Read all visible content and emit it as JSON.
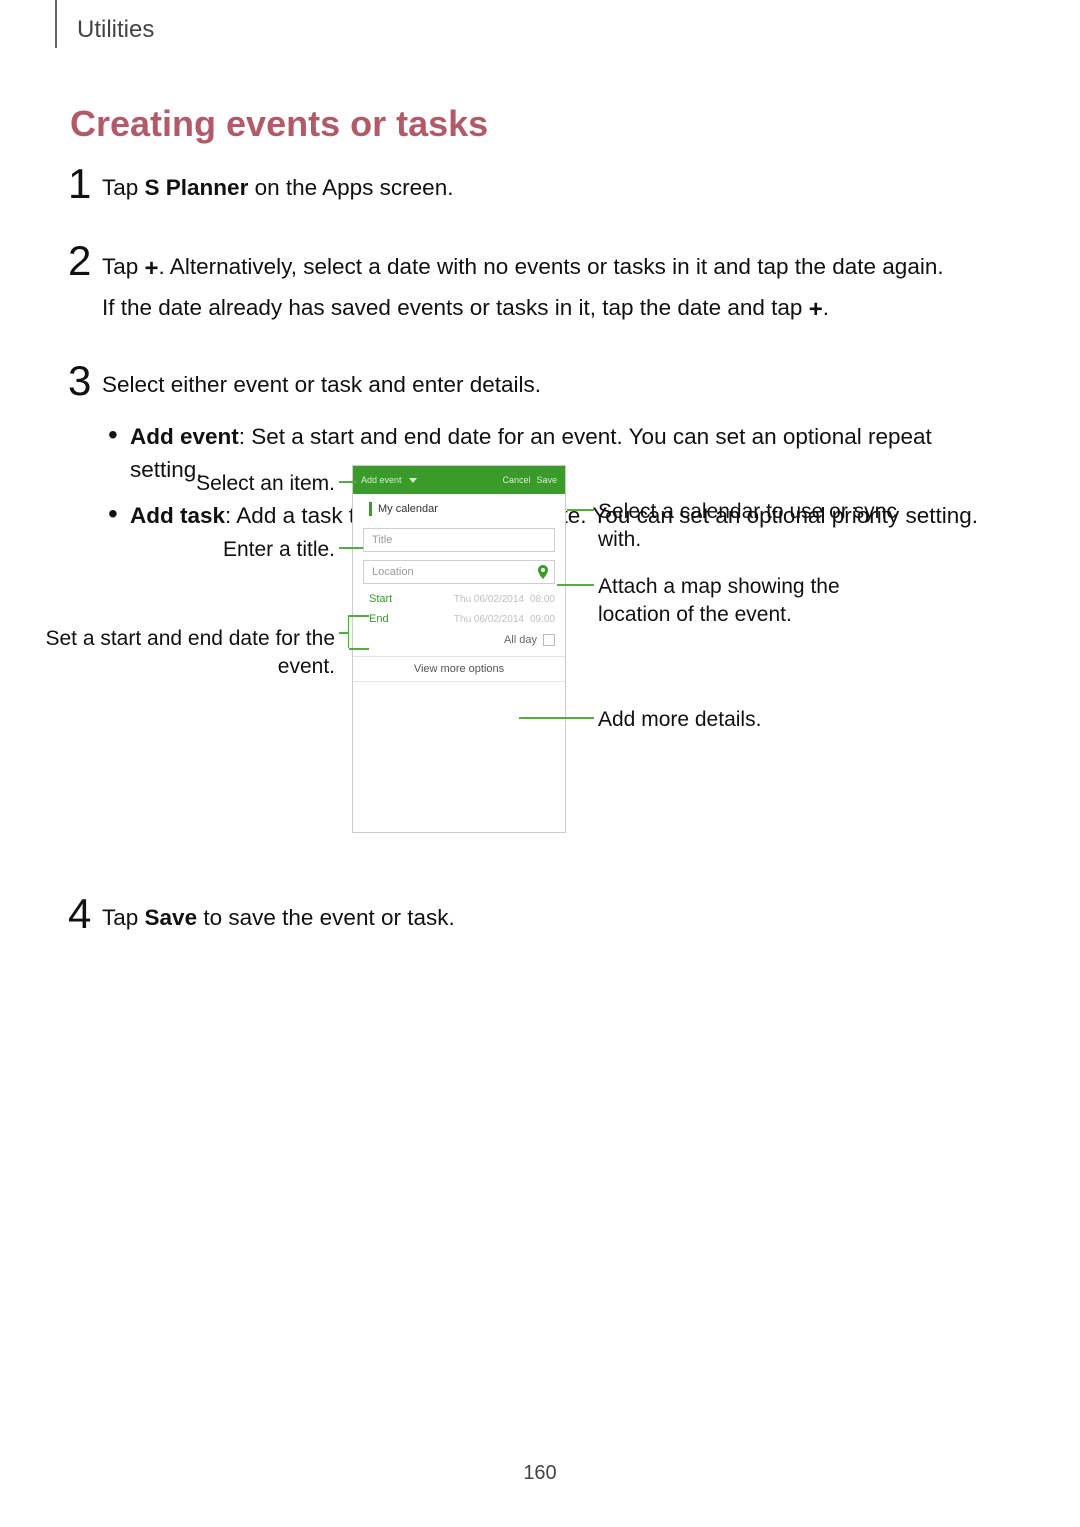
{
  "header": {
    "section": "Utilities"
  },
  "title": "Creating events or tasks",
  "steps": {
    "s1": {
      "num": "1",
      "pre": "Tap ",
      "bold": "S Planner",
      "post": " on the Apps screen."
    },
    "s2": {
      "num": "2",
      "line1_a": "Tap ",
      "line1_b": ". Alternatively, select a date with no events or tasks in it and tap the date again.",
      "line2_a": "If the date already has saved events or tasks in it, tap the date and tap ",
      "line2_b": "."
    },
    "s3": {
      "num": "3",
      "intro": "Select either event or task and enter details.",
      "bullets": {
        "b1_bold": "Add event",
        "b1_rest": ": Set a start and end date for an event. You can set an optional repeat setting.",
        "b2_bold": "Add task",
        "b2_rest": ": Add a task to do on a specific date. You can set an optional priority setting."
      }
    },
    "s4": {
      "num": "4",
      "pre": "Tap ",
      "bold": "Save",
      "post": " to save the event or task."
    }
  },
  "callouts": {
    "select_item": "Select an item.",
    "enter_title": "Enter a title.",
    "set_dates": "Set a start and end date for the event.",
    "select_calendar": "Select a calendar to use or sync with.",
    "attach_map": "Attach a map showing the location of the event.",
    "add_more": "Add more details."
  },
  "phone": {
    "header": {
      "add_event": "Add event",
      "cancel": "Cancel",
      "save": "Save"
    },
    "calendar_label": "My calendar",
    "title_placeholder": "Title",
    "location_placeholder": "Location",
    "start_label": "Start",
    "end_label": "End",
    "start_date": "Thu 06/02/2014",
    "start_time": "08:00",
    "end_date": "Thu 06/02/2014",
    "end_time": "09:00",
    "all_day": "All day",
    "view_more": "View more options"
  },
  "plus": "+",
  "page_number": "160"
}
